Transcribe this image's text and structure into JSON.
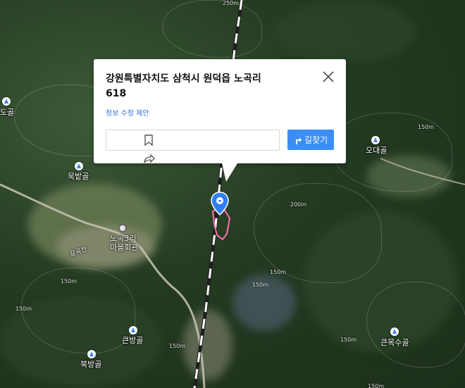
{
  "popup": {
    "address_line1": "강원특별자치도 삼척시 원덕읍 노곡리",
    "address_line2": "618",
    "suggest_edit": "정보 수정 제안",
    "directions_label": "길찾기"
  },
  "places": [
    {
      "name": "도골"
    },
    {
      "name": "묵밭골"
    },
    {
      "name": "오대골"
    },
    {
      "name": "큰방골"
    },
    {
      "name": "북방골"
    },
    {
      "name": "큰목수골"
    },
    {
      "name": "노곡3리"
    },
    {
      "name": "마을회관"
    },
    {
      "name": "갈곡천"
    }
  ],
  "elevations": [
    "250m",
    "150m",
    "200m",
    "150m",
    "150m",
    "150m",
    "150m",
    "150m",
    "150m",
    "150m"
  ],
  "colors": {
    "accent": "#3a8ef6",
    "parcel_outline": "#ff6fb2",
    "link": "#2f6fd6"
  }
}
